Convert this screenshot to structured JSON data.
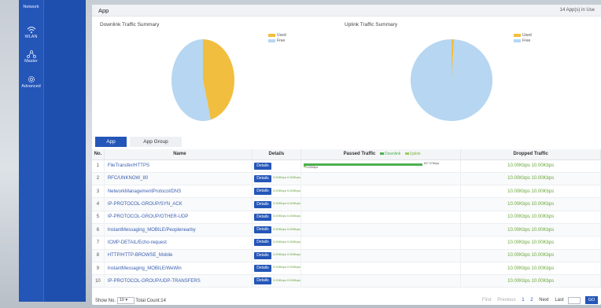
{
  "sidebar": {
    "items": [
      {
        "label": "Network",
        "icon": "network-icon"
      },
      {
        "label": "WLAN",
        "icon": "wifi-icon"
      },
      {
        "label": "Master",
        "icon": "topology-icon"
      },
      {
        "label": "Advanced",
        "icon": "gear-icon"
      }
    ]
  },
  "header": {
    "title": "App",
    "in_use": "14 App(s) in Use"
  },
  "charts": {
    "downlink": {
      "title": "Downlink Traffic Summary"
    },
    "uplink": {
      "title": "Uplink Traffic Summary"
    },
    "legend": {
      "used": "Used",
      "free": "Free"
    }
  },
  "chart_data": [
    {
      "type": "pie",
      "title": "Downlink Traffic Summary",
      "categories": [
        "Used",
        "Free"
      ],
      "values": [
        46,
        54
      ],
      "colors": [
        "#f2be3f",
        "#b6d6f2"
      ],
      "legend": "top-right"
    },
    {
      "type": "pie",
      "title": "Uplink Traffic Summary",
      "categories": [
        "Used",
        "Free"
      ],
      "values": [
        1,
        99
      ],
      "colors": [
        "#f2be3f",
        "#b6d6f2"
      ],
      "legend": "top-right"
    }
  ],
  "tabs": [
    {
      "label": "App"
    },
    {
      "label": "App Group"
    }
  ],
  "table": {
    "headers": {
      "no": "No.",
      "name": "Name",
      "details": "Details",
      "passed": "Passed Traffic",
      "downlink": "Downlink",
      "uplink": "Uplink",
      "dropped": "Dropped Traffic"
    },
    "details_label": "Details",
    "first_row_bar": {
      "down_label": "827.37Mbps",
      "up_label": "4.52Mbps",
      "down_fraction": 0.84,
      "up_fraction": 0.02
    },
    "rows": [
      {
        "no": "1",
        "name": "FileTransfer/HTTPS",
        "dropped": "10.00Kbps  10.00Kbps",
        "mini": ""
      },
      {
        "no": "2",
        "name": "RFC/UNKNOW_80",
        "dropped": "10.00Kbps  10.00Kbps",
        "mini": "0.00Kbps 0.00Kbps"
      },
      {
        "no": "3",
        "name": "NetworkManagementProtocol/DNS",
        "dropped": "10.00Kbps  10.00Kbps",
        "mini": "0.00Kbps 0.00Kbps"
      },
      {
        "no": "4",
        "name": "IP-PROTOCOL-GROUP/SYN_ACK",
        "dropped": "10.00Kbps  10.00Kbps",
        "mini": "0.00Kbps 0.00Kbps"
      },
      {
        "no": "5",
        "name": "IP-PROTOCOL-GROUP/OTHER-UDP",
        "dropped": "10.00Kbps  10.00Kbps",
        "mini": "0.00Kbps 0.00Kbps"
      },
      {
        "no": "6",
        "name": "InstantMessaging_MOBILE/Peoplenearby",
        "dropped": "10.00Kbps  10.00Kbps",
        "mini": "0.00Kbps 0.00Kbps"
      },
      {
        "no": "7",
        "name": "ICMP-DETAIL/Echo-request",
        "dropped": "10.00Kbps  10.00Kbps",
        "mini": "0.00Kbps 0.00Kbps"
      },
      {
        "no": "8",
        "name": "HTTP/HTTP-BROWSE_Mobile",
        "dropped": "10.00Kbps  10.00Kbps",
        "mini": "0.00Kbps 0.00Kbps"
      },
      {
        "no": "9",
        "name": "InstantMessaging_MOBILE/WeWin",
        "dropped": "10.00Kbps  10.00Kbps",
        "mini": "0.00Kbps 0.00Kbps"
      },
      {
        "no": "10",
        "name": "IP-PROTOCOL-GROUP/UDP-TRANSFERS",
        "dropped": "10.00Kbps  10.00Kbps",
        "mini": "0.00Kbps 0.00Kbps"
      }
    ]
  },
  "footer": {
    "show_no": "Show No.",
    "page_size": "10",
    "total": "Total Count:14",
    "first": "First",
    "previous": "Previous",
    "page1": "1",
    "page2": "2",
    "next": "Next",
    "last": "Last",
    "go": "GO"
  },
  "colors": {
    "accent": "#2456b8",
    "used": "#f2be3f",
    "free": "#b6d6f2",
    "traffic_green": "#4caf50"
  }
}
